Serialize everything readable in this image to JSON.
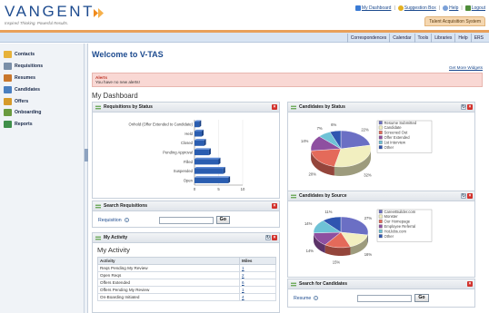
{
  "header": {
    "logo": "VANGENT",
    "tagline": "Inspired Thinking. Powerful Results.",
    "links": [
      {
        "label": "My Dashboard",
        "icon": "dashboard-icon",
        "color": "#3a7bd5"
      },
      {
        "label": "Suggestion Box",
        "icon": "lightbulb-icon",
        "color": "#e3b021"
      },
      {
        "label": "Help",
        "icon": "help-icon",
        "color": "#7aa0d8"
      },
      {
        "label": "Logout",
        "icon": "logout-icon",
        "color": "#4f8d3a"
      }
    ],
    "system_badge": "Talent Acquisition System"
  },
  "nav": {
    "tabs": [
      "Correspondences",
      "Calendar",
      "Tools",
      "Libraries",
      "Help",
      "ERS"
    ]
  },
  "sidebar": {
    "items": [
      {
        "label": "Contacts",
        "icon": "contacts-icon",
        "color": "#e7b23a"
      },
      {
        "label": "Requisitions",
        "icon": "requisitions-icon",
        "color": "#7a8fa8"
      },
      {
        "label": "Resumes",
        "icon": "resumes-icon",
        "color": "#c9772c"
      },
      {
        "label": "Candidates",
        "icon": "candidates-icon",
        "color": "#4a7fc0"
      },
      {
        "label": "Offers",
        "icon": "offers-icon",
        "color": "#d69a2a"
      },
      {
        "label": "Onboarding",
        "icon": "onboarding-icon",
        "color": "#6a9a3f"
      },
      {
        "label": "Reports",
        "icon": "reports-icon",
        "color": "#3f8f4a"
      }
    ]
  },
  "main": {
    "welcome": "Welcome to V-TAS",
    "more_widgets": "Get More Widgets",
    "alerts_title": "Alerts",
    "alerts_message": "You have no new alerts!",
    "dashboard_title": "My Dashboard"
  },
  "widgets": {
    "requisitions_by_status": {
      "title": "Requisitions by Status"
    },
    "search_requisitions": {
      "title": "Search Requisitions",
      "field_label": "Requisition",
      "input_value": "",
      "go_label": "Go"
    },
    "my_activity": {
      "title": "My Activity",
      "heading": "My Activity",
      "columns": [
        "Activity",
        "Miles"
      ],
      "rows": [
        {
          "activity": "Reqs Pending My Review",
          "miles": "1"
        },
        {
          "activity": "Open Reqs",
          "miles": "2"
        },
        {
          "activity": "Offers Extended",
          "miles": "6"
        },
        {
          "activity": "Offers Pending My Review",
          "miles": "1"
        },
        {
          "activity": "On-Boarding Initiated",
          "miles": "4"
        }
      ]
    },
    "candidates_by_status": {
      "title": "Candidates by Status"
    },
    "candidates_by_source": {
      "title": "Candidates by Source"
    },
    "search_candidates": {
      "title": "Search for Candidates",
      "field_label": "Resume",
      "input_value": "",
      "go_label": "Go"
    }
  },
  "chart_data": [
    {
      "type": "bar",
      "orientation": "horizontal",
      "categories": [
        "Onhold (Offer Extended to Candidate)",
        "Held",
        "Closed",
        "Pending Approval",
        "Filled",
        "Suspended",
        "Open"
      ],
      "values": [
        1,
        1.5,
        2,
        3,
        5,
        6,
        7
      ],
      "xlim": [
        0,
        10
      ],
      "xticks": [
        0,
        5,
        10
      ],
      "color": "#2a5db0"
    },
    {
      "type": "pie",
      "style": "3d",
      "labels": [
        "Resume Submitted",
        "Candidate",
        "Screened Out",
        "Offer Extended",
        "1st Interview",
        "Other"
      ],
      "values": [
        22,
        32,
        20,
        14,
        7,
        6
      ],
      "data_labels": [
        "22%",
        "32%",
        "20%",
        "14%",
        "7%",
        "6%"
      ],
      "colors": [
        "#6b6fc4",
        "#f2efc0",
        "#e46a5a",
        "#8e4fa0",
        "#6ec2d6",
        "#2f55b0"
      ],
      "legend": "right"
    },
    {
      "type": "pie",
      "style": "3d",
      "labels": [
        "CareerBuilder.com",
        "Monster",
        "Our Homepage",
        "Employee Referral",
        "HotJobs.com",
        "Other"
      ],
      "values": [
        27,
        16,
        15,
        14,
        14,
        11
      ],
      "data_labels": [
        "27%",
        "16%",
        "15%",
        "14%",
        "14%",
        "11%"
      ],
      "colors": [
        "#6b6fc4",
        "#f2efc0",
        "#e46a5a",
        "#8e4fa0",
        "#6ec2d6",
        "#2f55b0"
      ],
      "legend": "right"
    }
  ]
}
